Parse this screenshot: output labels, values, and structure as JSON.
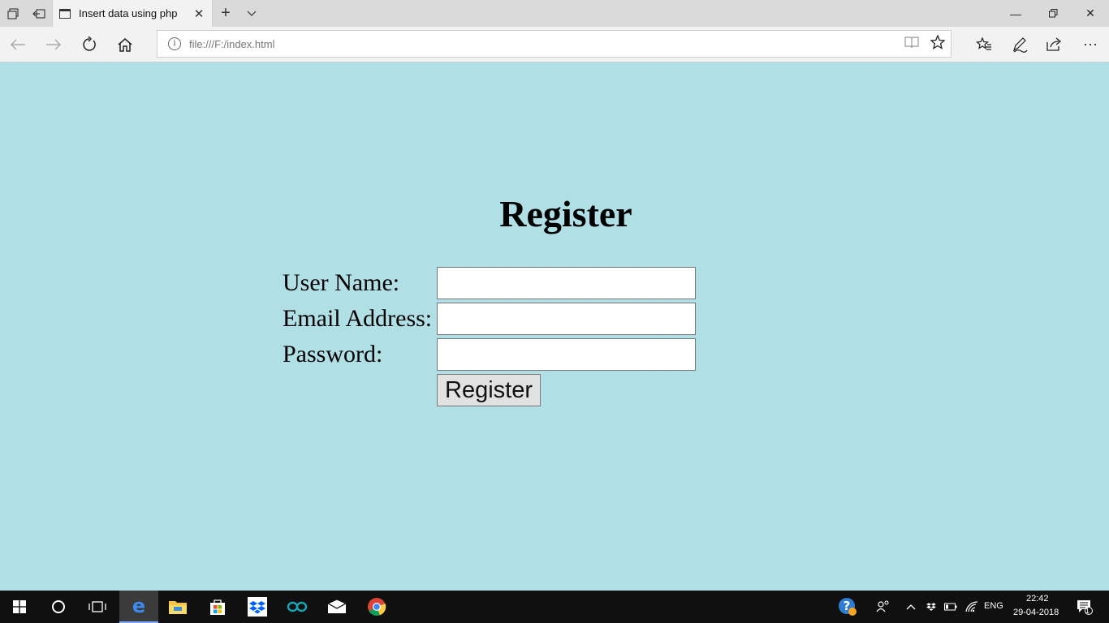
{
  "browser": {
    "tab_title": "Insert data using php",
    "url": "file:///F:/index.html"
  },
  "page": {
    "title": "Register",
    "fields": [
      {
        "label": "User Name:",
        "value": ""
      },
      {
        "label": "Email Address:",
        "value": ""
      },
      {
        "label": "Password:",
        "value": ""
      }
    ],
    "submit_label": "Register",
    "background": "#b0dfe5"
  },
  "taskbar": {
    "language": "ENG",
    "time": "22:42",
    "date": "29-04-2018",
    "notification_count": "1"
  }
}
